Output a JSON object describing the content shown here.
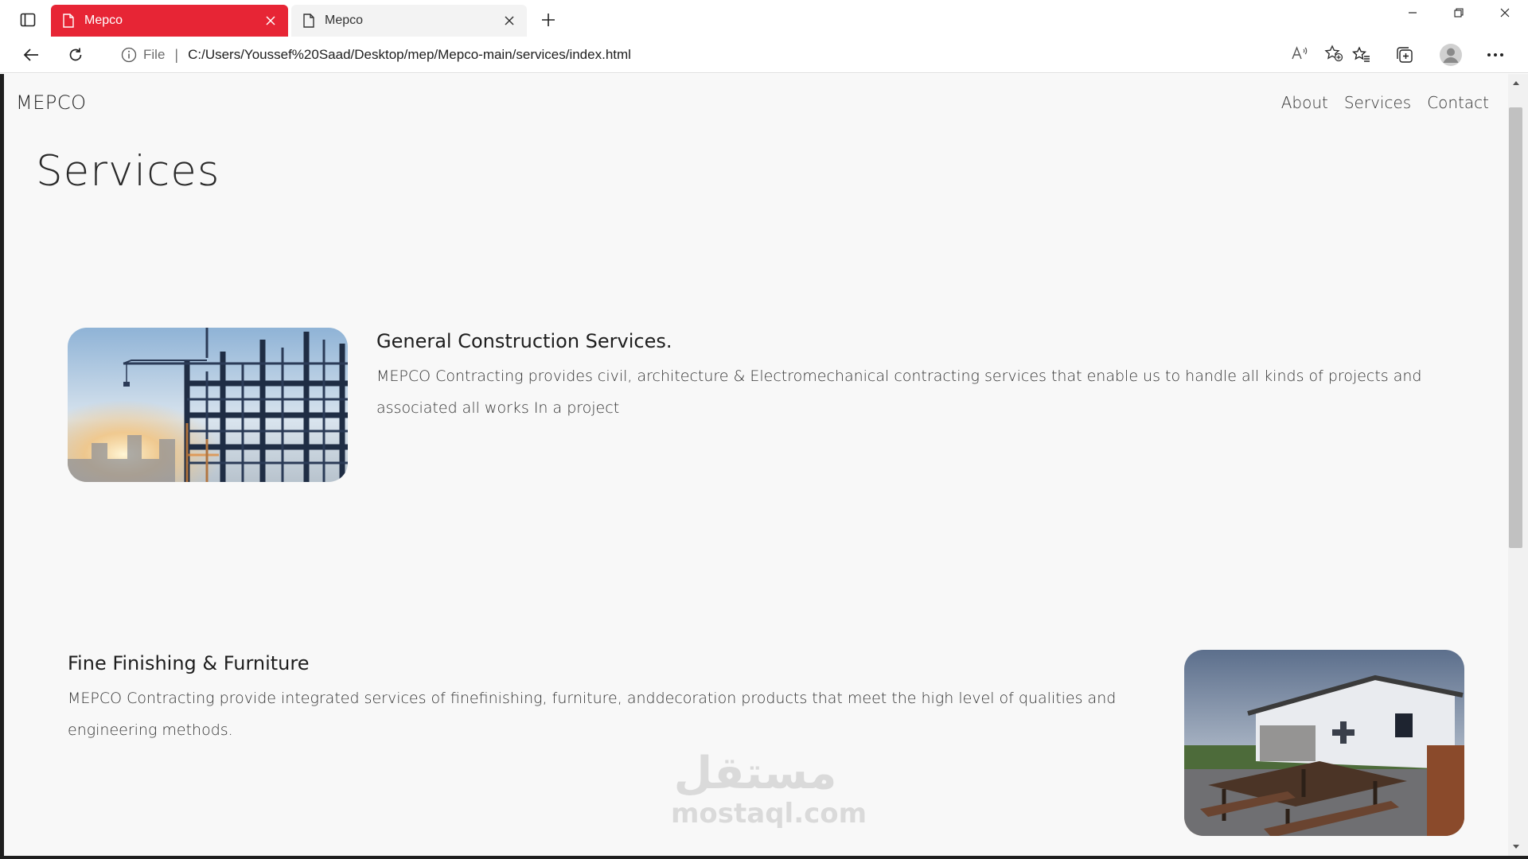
{
  "browser": {
    "tabs": [
      {
        "title": "Mepco",
        "active": true
      },
      {
        "title": "Mepco",
        "active": false
      }
    ],
    "address": {
      "scheme_label": "File",
      "url": "C:/Users/Youssef%20Saad/Desktop/mep/Mepco-main/services/index.html"
    },
    "accent_color": "#e72535"
  },
  "site": {
    "brand": "MEPCO",
    "nav": [
      "About",
      "Services",
      "Contact"
    ],
    "page_title": "Services",
    "services": [
      {
        "heading": "General Construction Services.",
        "text": "MEPCO Contracting provides civil, architecture & Electromechanical contracting services that enable us to handle all kinds of projects and associated all works In a project"
      },
      {
        "heading": "Fine Finishing & Furniture",
        "text": "MEPCO Contracting provide integrated services of finefinishing, furniture, anddecoration products that meet the high level of qualities and engineering methods."
      }
    ]
  },
  "watermark": {
    "arabic": "مستقل",
    "latin": "mostaql.com"
  }
}
